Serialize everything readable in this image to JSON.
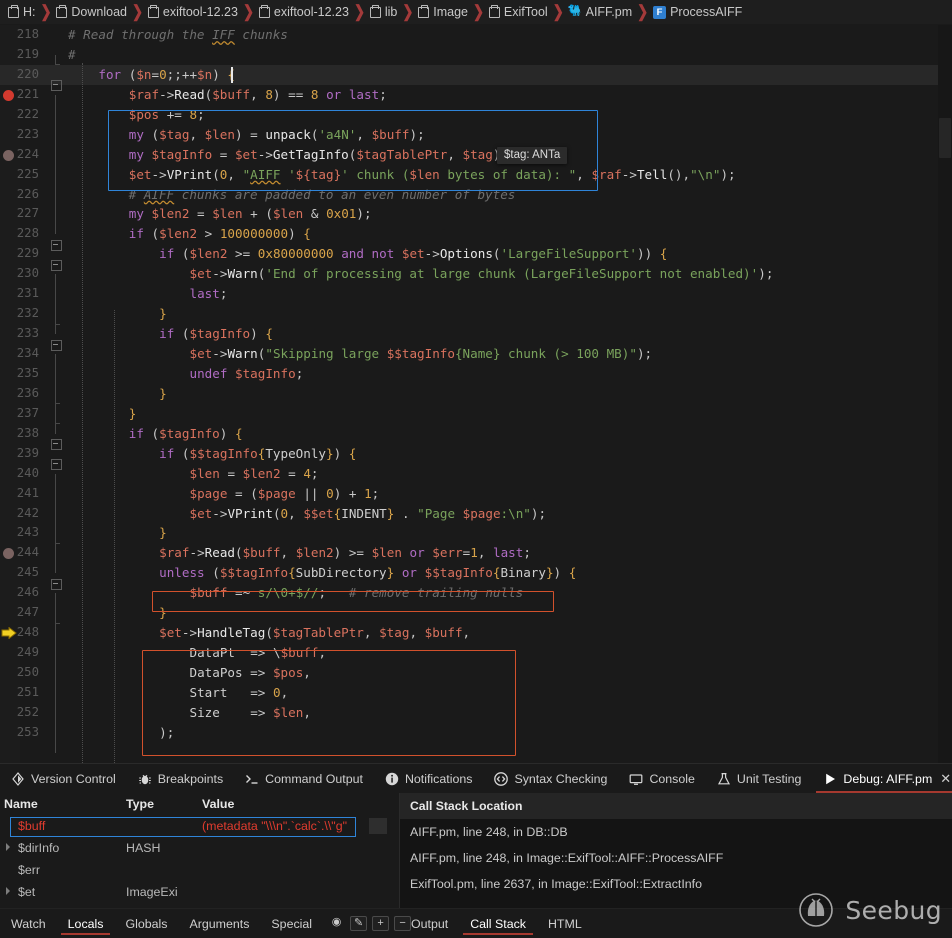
{
  "breadcrumb": {
    "items": [
      {
        "label": "H:",
        "icon": "folder-icon"
      },
      {
        "label": "Download",
        "icon": "folder-icon"
      },
      {
        "label": "exiftool-12.23",
        "icon": "folder-icon"
      },
      {
        "label": "exiftool-12.23",
        "icon": "folder-icon"
      },
      {
        "label": "lib",
        "icon": "folder-icon"
      },
      {
        "label": "Image",
        "icon": "folder-icon"
      },
      {
        "label": "ExifTool",
        "icon": "folder-icon"
      },
      {
        "label": "AIFF.pm",
        "icon": "perl-camel-icon"
      },
      {
        "label": "ProcessAIFF",
        "icon": "function-icon"
      }
    ],
    "separator": "❯"
  },
  "editor": {
    "first_line": 218,
    "current_line": 220,
    "execution_line": 248,
    "breakpoints_enabled": [
      221
    ],
    "breakpoints_disabled": [
      224,
      244
    ],
    "lines": [
      {
        "n": 218,
        "fold": "none",
        "text": "# Read through the IFF chunks"
      },
      {
        "n": 219,
        "fold": "tee",
        "text": "#"
      },
      {
        "n": 220,
        "fold": "box",
        "text": "    for ($n=0;;++$n) {"
      },
      {
        "n": 221,
        "fold": "bar",
        "text": "        $raf->Read($buff, 8) == 8 or last;"
      },
      {
        "n": 222,
        "fold": "bar",
        "text": "        $pos += 8;"
      },
      {
        "n": 223,
        "fold": "bar",
        "text": "        my ($tag, $len) = unpack('a4N', $buff);"
      },
      {
        "n": 224,
        "fold": "bar",
        "text": "        my $tagInfo = $et->GetTagInfo($tagTablePtr, $tag);"
      },
      {
        "n": 225,
        "fold": "bar",
        "text": "        $et->VPrint(0, \"AIFF '${tag}' chunk ($len bytes of data): \", $raf->Tell(),\"\\n\");"
      },
      {
        "n": 226,
        "fold": "bar",
        "text": "        # AIFF chunks are padded to an even number of bytes"
      },
      {
        "n": 227,
        "fold": "bar",
        "text": "        my $len2 = $len + ($len & 0x01);"
      },
      {
        "n": 228,
        "fold": "box",
        "text": "        if ($len2 > 100000000) {"
      },
      {
        "n": 229,
        "fold": "box",
        "text": "            if ($len2 >= 0x80000000 and not $et->Options('LargeFileSupport')) {"
      },
      {
        "n": 230,
        "fold": "bar",
        "text": "                $et->Warn('End of processing at large chunk (LargeFileSupport not enabled)');"
      },
      {
        "n": 231,
        "fold": "bar",
        "text": "                last;"
      },
      {
        "n": 232,
        "fold": "tee",
        "text": "            }"
      },
      {
        "n": 233,
        "fold": "box",
        "text": "            if ($tagInfo) {"
      },
      {
        "n": 234,
        "fold": "bar",
        "text": "                $et->Warn(\"Skipping large $$tagInfo{Name} chunk (> 100 MB)\");"
      },
      {
        "n": 235,
        "fold": "bar",
        "text": "                undef $tagInfo;"
      },
      {
        "n": 236,
        "fold": "tee",
        "text": "            }"
      },
      {
        "n": 237,
        "fold": "tee",
        "text": "        }"
      },
      {
        "n": 238,
        "fold": "box",
        "text": "        if ($tagInfo) {"
      },
      {
        "n": 239,
        "fold": "box",
        "text": "            if ($$tagInfo{TypeOnly}) {"
      },
      {
        "n": 240,
        "fold": "bar",
        "text": "                $len = $len2 = 4;"
      },
      {
        "n": 241,
        "fold": "bar",
        "text": "                $page = ($page || 0) + 1;"
      },
      {
        "n": 242,
        "fold": "bar",
        "text": "                $et->VPrint(0, $$et{INDENT} . \"Page $page:\\n\");"
      },
      {
        "n": 243,
        "fold": "tee",
        "text": "            }"
      },
      {
        "n": 244,
        "fold": "bar",
        "text": "            $raf->Read($buff, $len2) >= $len or $err=1, last;"
      },
      {
        "n": 245,
        "fold": "box",
        "text": "            unless ($$tagInfo{SubDirectory} or $$tagInfo{Binary}) {"
      },
      {
        "n": 246,
        "fold": "bar",
        "text": "                $buff =~ s/\\0+$//;   # remove trailing nulls"
      },
      {
        "n": 247,
        "fold": "tee",
        "text": "            }"
      },
      {
        "n": 248,
        "fold": "bar",
        "text": "            $et->HandleTag($tagTablePtr, $tag, $buff,"
      },
      {
        "n": 249,
        "fold": "bar",
        "text": "                DataPt  => \\$buff,"
      },
      {
        "n": 250,
        "fold": "bar",
        "text": "                DataPos => $pos,"
      },
      {
        "n": 251,
        "fold": "bar",
        "text": "                Start   => 0,"
      },
      {
        "n": 252,
        "fold": "bar",
        "text": "                Size    => $len,"
      },
      {
        "n": 253,
        "fold": "bar",
        "text": "            );"
      }
    ],
    "tooltip": "$tag: ANTa"
  },
  "panel_tabs": [
    {
      "label": "Version Control",
      "icon": "branch-icon",
      "active": false
    },
    {
      "label": "Breakpoints",
      "icon": "bug-icon",
      "active": false
    },
    {
      "label": "Command Output",
      "icon": "terminal-icon",
      "active": false
    },
    {
      "label": "Notifications",
      "icon": "info-icon",
      "active": false
    },
    {
      "label": "Syntax Checking",
      "icon": "code-icon",
      "active": false
    },
    {
      "label": "Console",
      "icon": "monitor-icon",
      "active": false
    },
    {
      "label": "Unit Testing",
      "icon": "flask-icon",
      "active": false
    },
    {
      "label": "Debug: AIFF.pm",
      "icon": "play-icon",
      "active": true,
      "closable": true
    }
  ],
  "variables": {
    "headers": {
      "name": "Name",
      "type": "Type",
      "value": "Value"
    },
    "rows": [
      {
        "name": "$buff",
        "type": "",
        "value": "(metadata \"\\\\\\n\".`calc`.\\\\\"g\"",
        "selected": true,
        "expandable": false
      },
      {
        "name": "$dirInfo",
        "type": "HASH",
        "value": "",
        "selected": false,
        "expandable": true
      },
      {
        "name": "$err",
        "type": "",
        "value": "",
        "selected": false,
        "expandable": false
      },
      {
        "name": "$et",
        "type": "ImageExi",
        "value": "",
        "selected": false,
        "expandable": true
      }
    ]
  },
  "call_stack": {
    "header": "Call Stack Location",
    "rows": [
      "AIFF.pm, line 248, in DB::DB",
      "AIFF.pm, line 248, in Image::ExifTool::AIFF::ProcessAIFF",
      "ExifTool.pm, line 2637, in Image::ExifTool::ExtractInfo"
    ]
  },
  "sub_tabs": {
    "left": [
      {
        "label": "Watch",
        "active": false
      },
      {
        "label": "Locals",
        "active": true
      },
      {
        "label": "Globals",
        "active": false
      },
      {
        "label": "Arguments",
        "active": false
      },
      {
        "label": "Special",
        "active": false
      }
    ],
    "tools": [
      {
        "icon": "eye-icon",
        "label": "◉"
      },
      {
        "icon": "edit-pencil-icon",
        "label": "✎"
      },
      {
        "icon": "plus-icon",
        "label": "+"
      },
      {
        "icon": "minus-icon",
        "label": "−"
      }
    ],
    "right": [
      {
        "label": "Output",
        "active": false
      },
      {
        "label": "Call Stack",
        "active": true
      },
      {
        "label": "HTML",
        "active": false
      }
    ]
  },
  "watermark": {
    "text": "Seebug",
    "icon": "seebug-bug-icon"
  },
  "colors": {
    "accent_red": "#a6392f",
    "breakpoint": "#d33a2f",
    "highlight_blue": "#2f84d8",
    "highlight_red": "#d2512c",
    "background": "#1a1a1a"
  }
}
